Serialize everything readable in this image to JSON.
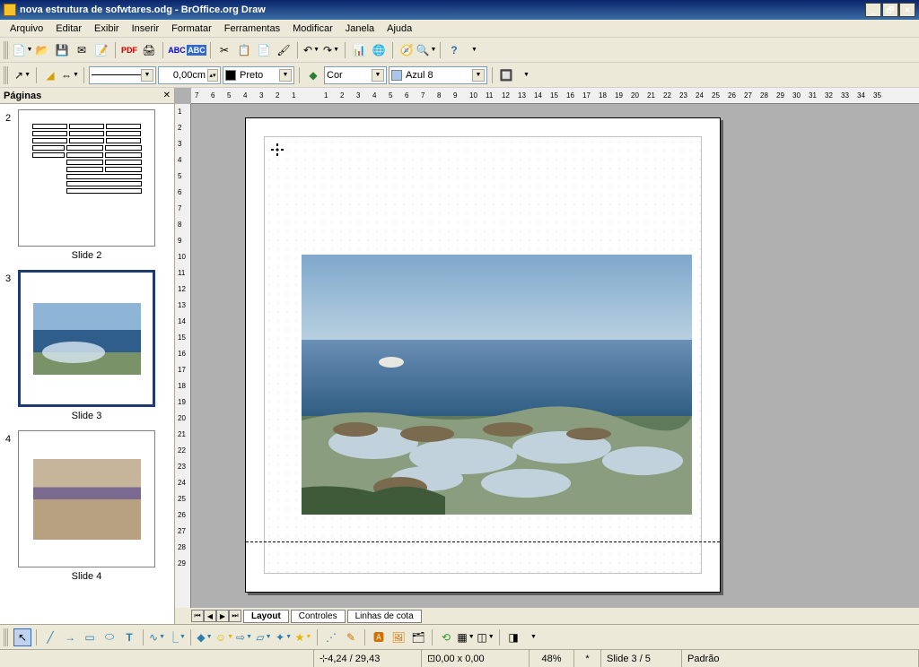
{
  "titlebar": {
    "title": "nova estrutura de sofwtares.odg - BrOffice.org Draw"
  },
  "menu": {
    "arquivo": "Arquivo",
    "editar": "Editar",
    "exibir": "Exibir",
    "inserir": "Inserir",
    "formatar": "Formatar",
    "ferramentas": "Ferramentas",
    "modificar": "Modificar",
    "janela": "Janela",
    "ajuda": "Ajuda"
  },
  "format": {
    "linewidth": "0,00cm",
    "linecolor": "Preto",
    "filltype": "Cor",
    "fillcolor": "Azul 8",
    "fillhex": "#A8C8E8",
    "linecolorhex": "#000000"
  },
  "panel": {
    "title": "Páginas",
    "slide2_num": "2",
    "slide2_label": "Slide 2",
    "slide3_num": "3",
    "slide3_label": "Slide 3",
    "slide4_num": "4",
    "slide4_label": "Slide 4"
  },
  "ruler": {
    "h": [
      "7",
      "6",
      "5",
      "4",
      "3",
      "2",
      "1",
      "",
      "1",
      "2",
      "3",
      "4",
      "5",
      "6",
      "7",
      "8",
      "9",
      "10",
      "11",
      "12",
      "13",
      "14",
      "15",
      "16",
      "17",
      "18",
      "19",
      "20",
      "21",
      "22",
      "23",
      "24",
      "25",
      "26",
      "27",
      "28",
      "29",
      "30",
      "31",
      "32",
      "33",
      "34",
      "35"
    ],
    "v": [
      "1",
      "2",
      "3",
      "4",
      "5",
      "6",
      "7",
      "8",
      "9",
      "10",
      "11",
      "12",
      "13",
      "14",
      "15",
      "16",
      "17",
      "18",
      "19",
      "20",
      "21",
      "22",
      "23",
      "24",
      "25",
      "26",
      "27",
      "28",
      "29"
    ]
  },
  "tabs": {
    "layout": "Layout",
    "controles": "Controles",
    "linhas": "Linhas de cota"
  },
  "status": {
    "pos": "4,24 / 29,43",
    "size": "0,00 x 0,00",
    "zoom": "48%",
    "modified": "*",
    "slidenum": "Slide 3 / 5",
    "layout": "Padrão"
  }
}
